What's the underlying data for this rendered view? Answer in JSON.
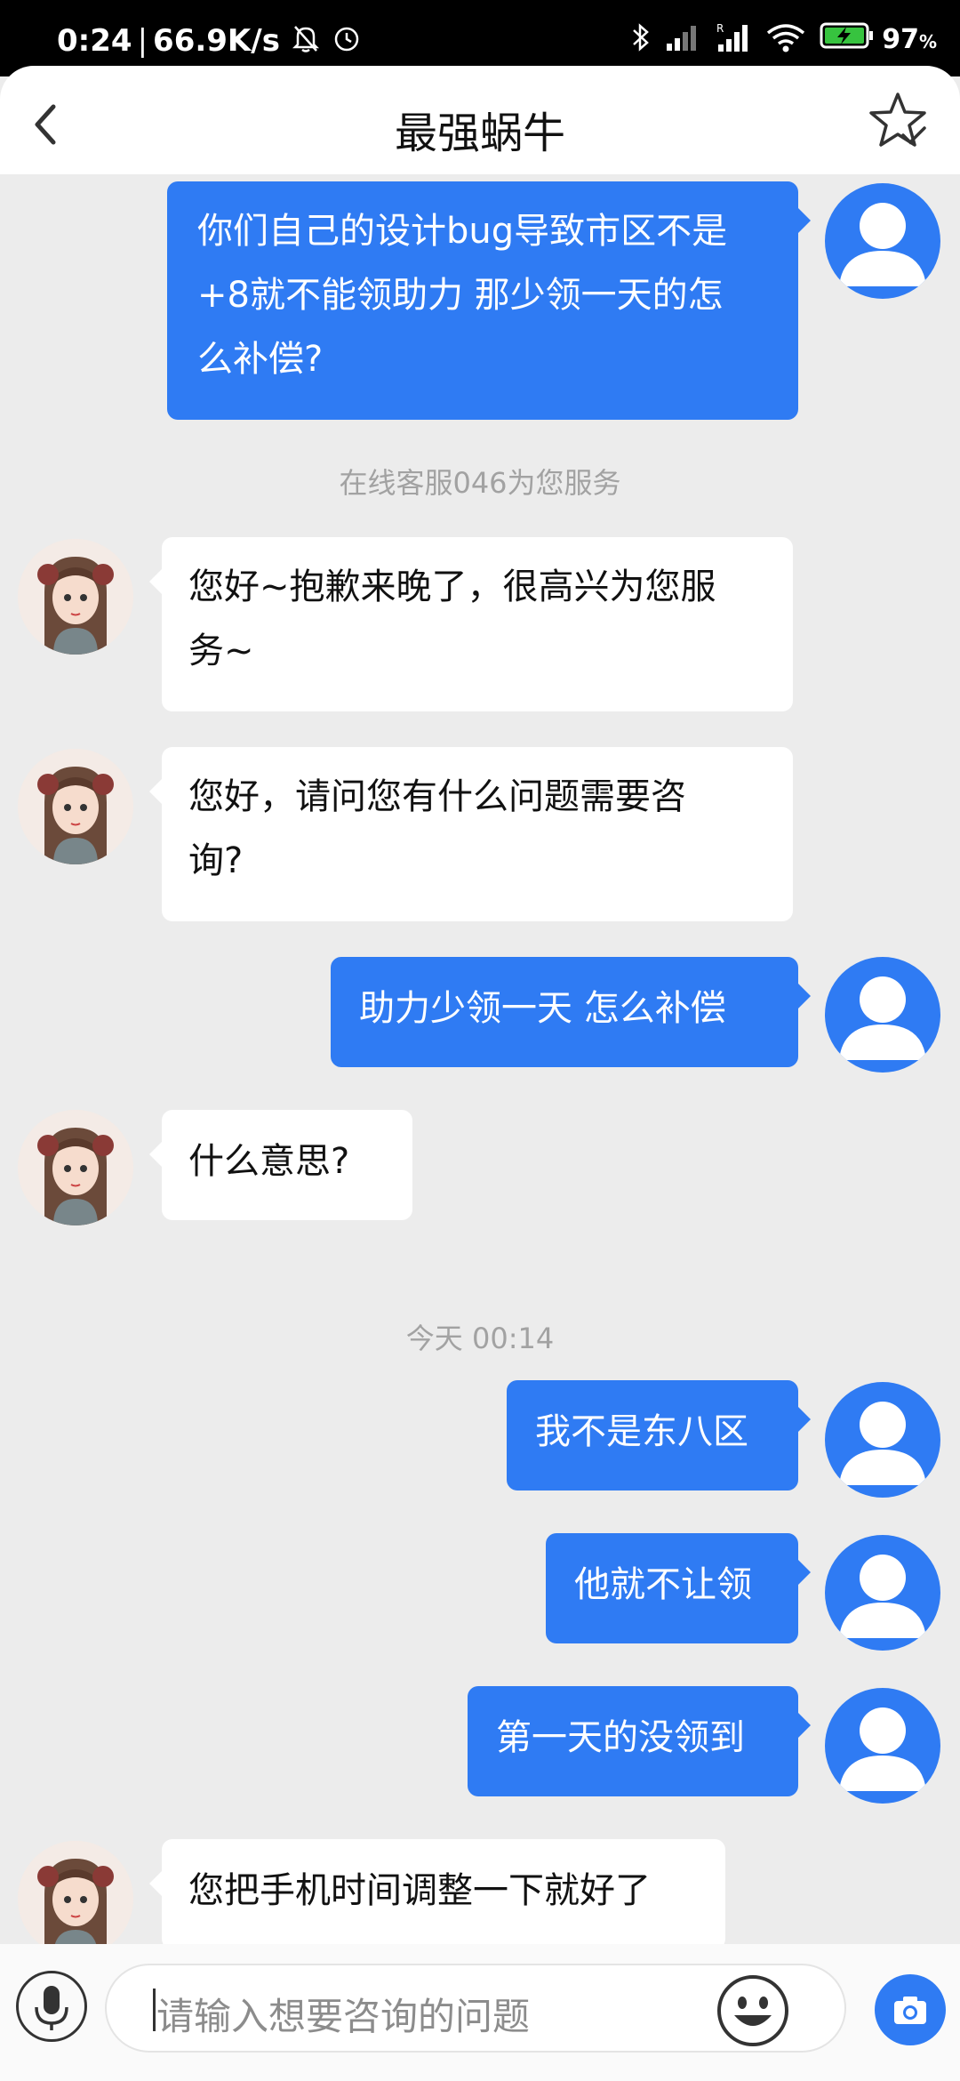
{
  "status_bar": {
    "time": "0:24",
    "network_speed": "66.9K/s",
    "battery_percent": "97",
    "battery_unit": "%"
  },
  "header": {
    "title": "最强蜗牛",
    "back_icon": "chevron-left-icon",
    "favorite_icon": "star-check-icon"
  },
  "messages": [
    {
      "side": "out",
      "lines": [
        "你们自己的设计bug导致市区不是",
        "+8就不能领助力  那少领一天的怎",
        "么补偿?"
      ]
    },
    {
      "side": "system",
      "text": "在线客服046为您服务"
    },
    {
      "side": "in",
      "lines": [
        "您好~抱歉来晚了，很高兴为您服",
        "务~"
      ]
    },
    {
      "side": "in",
      "lines": [
        "您好，请问您有什么问题需要咨",
        "询?"
      ]
    },
    {
      "side": "out",
      "lines": [
        "助力少领一天  怎么补偿"
      ]
    },
    {
      "side": "in",
      "lines": [
        "什么意思?"
      ]
    },
    {
      "side": "system",
      "text": "今天 00:14"
    },
    {
      "side": "out",
      "lines": [
        "我不是东八区"
      ]
    },
    {
      "side": "out",
      "lines": [
        "他就不让领"
      ]
    },
    {
      "side": "out",
      "lines": [
        "第一天的没领到"
      ]
    },
    {
      "side": "in",
      "lines": [
        "您把手机时间调整一下就好了"
      ]
    }
  ],
  "input_bar": {
    "placeholder": "请输入想要咨询的问题",
    "voice_icon": "microphone-icon",
    "emoji_icon": "smiley-icon",
    "camera_icon": "camera-icon"
  },
  "colors": {
    "accent": "#2f7bf3",
    "background": "#ececec",
    "incoming_bubble": "#ffffff"
  }
}
